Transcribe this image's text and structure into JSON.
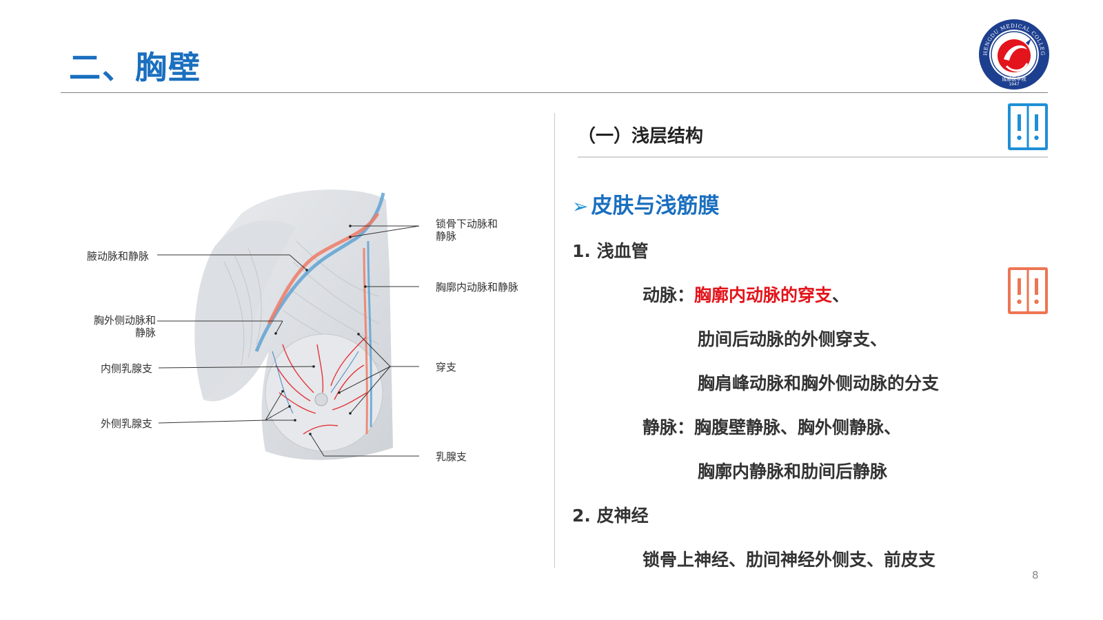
{
  "slide": {
    "title": "二、胸壁",
    "page_number": "8",
    "logo": {
      "ring_text": "CHENGDU MEDICAL COLLEGE",
      "cn_text": "成都医学院",
      "year": "1947",
      "colors": {
        "ring": "#1d3f8f",
        "center": "#e3141b"
      }
    }
  },
  "figure": {
    "labels": {
      "subclavian": "锁骨下动脉和\n静脉",
      "axillary": "腋动脉和静脉",
      "internal_thoracic": "胸廓内动脉和静脉",
      "lateral_thoracic": "胸外侧动脉和\n静脉",
      "perforating": "穿支",
      "medial_mammary": "内侧乳腺支",
      "lateral_mammary": "外侧乳腺支",
      "mammary": "乳腺支"
    }
  },
  "content": {
    "section_heading": "（一）浅层结构",
    "subheading_arrow": "➢",
    "subheading": "皮肤与浅筋膜",
    "item1_title": "1. 浅血管",
    "artery_label": "动脉：",
    "artery_highlight": "胸廓内动脉的穿支",
    "artery_highlight_sep": "、",
    "artery_line2": "肋间后动脉的外侧穿支、",
    "artery_line3": "胸肩峰动脉和胸外侧动脉的分支",
    "vein_label": "静脉：",
    "vein_line1": "胸腹壁静脉、胸外侧静脉、",
    "vein_line2": "胸廓内静脉和肋间后静脉",
    "item2_title": "2. 皮神经",
    "nerve_line": "锁骨上神经、肋间神经外侧支、前皮支"
  },
  "colors": {
    "title": "#1a6fbf",
    "highlight": "#e3141b",
    "badge_blue": "#1f8fd6",
    "badge_orange": "#ee7453"
  }
}
